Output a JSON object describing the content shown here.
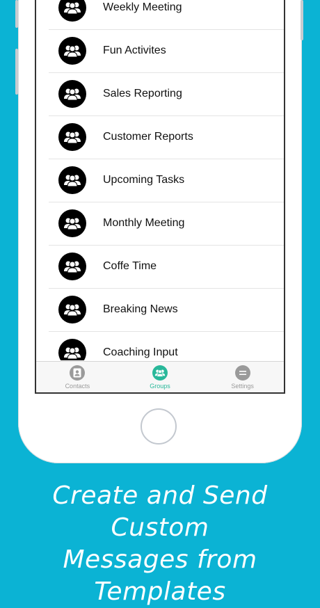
{
  "colors": {
    "background": "#0bb3d4",
    "active_tab": "#29b89a",
    "inactive_tab": "#9a9a9a"
  },
  "groups": [
    {
      "label": "Weekly Meeting",
      "icon": "group-icon"
    },
    {
      "label": "Fun Activites",
      "icon": "group-icon"
    },
    {
      "label": "Sales Reporting",
      "icon": "group-icon"
    },
    {
      "label": "Customer Reports",
      "icon": "group-icon"
    },
    {
      "label": "Upcoming Tasks",
      "icon": "group-icon"
    },
    {
      "label": "Monthly Meeting",
      "icon": "group-icon"
    },
    {
      "label": "Coffe Time",
      "icon": "group-icon"
    },
    {
      "label": "Breaking News",
      "icon": "group-icon"
    },
    {
      "label": "Coaching Input",
      "icon": "group-icon"
    }
  ],
  "tabs": [
    {
      "label": "Contacts",
      "icon": "contact-card-icon",
      "active": false
    },
    {
      "label": "Groups",
      "icon": "group-icon",
      "active": true
    },
    {
      "label": "Settings",
      "icon": "settings-icon",
      "active": false
    }
  ],
  "caption": {
    "line1": "Create and Send Custom",
    "line2": "Messages from Templates"
  }
}
